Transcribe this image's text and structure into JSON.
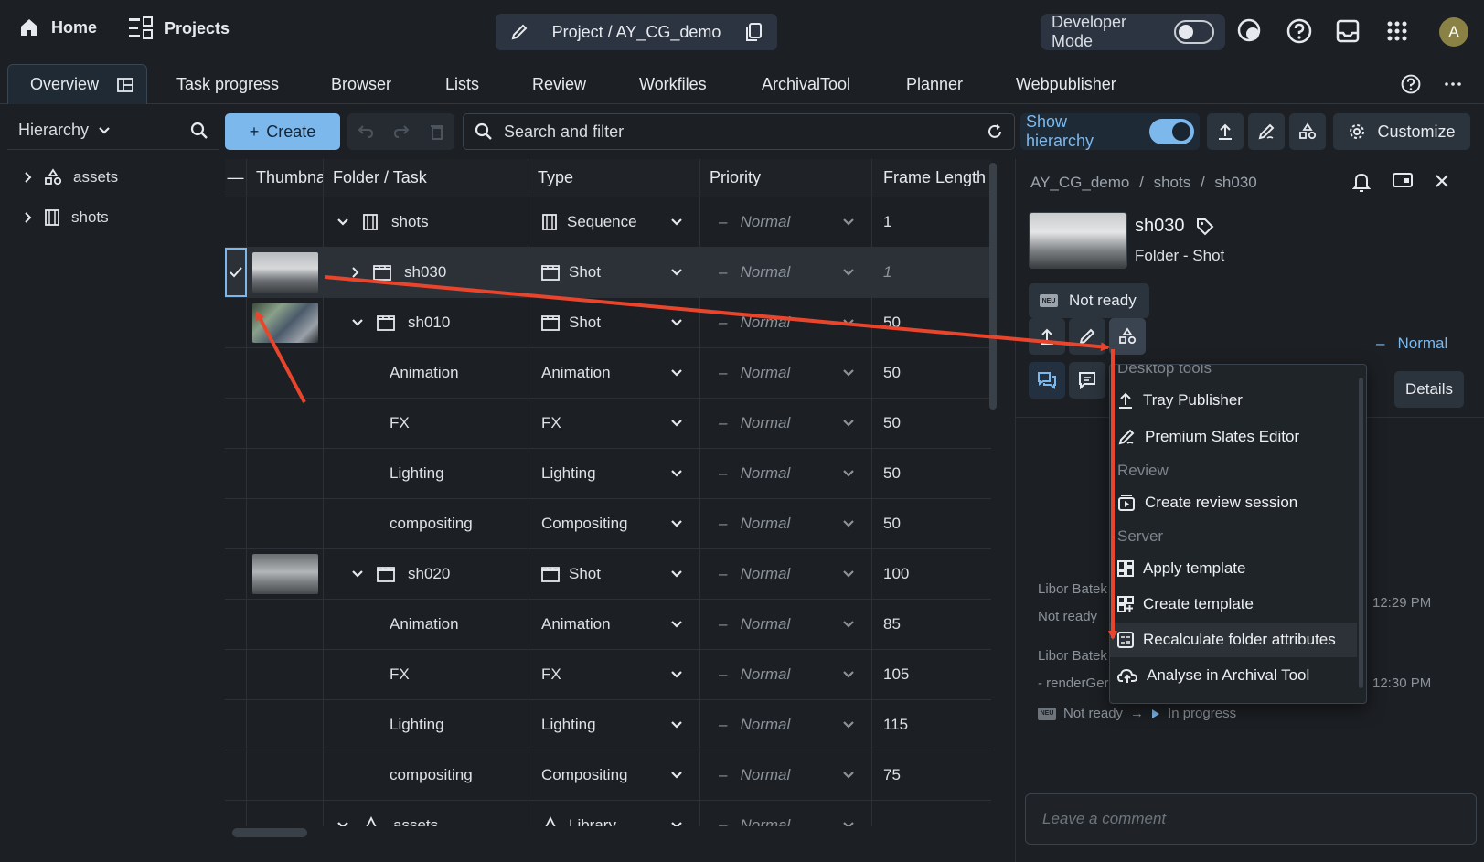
{
  "topbar": {
    "home_label": "Home",
    "projects_label": "Projects",
    "project_title": "Project / AY_CG_demo",
    "dev_mode_label": "Developer Mode",
    "avatar_initial": "A"
  },
  "tabs": [
    {
      "label": "Overview"
    },
    {
      "label": "Task progress"
    },
    {
      "label": "Browser"
    },
    {
      "label": "Lists"
    },
    {
      "label": "Review"
    },
    {
      "label": "Workfiles"
    },
    {
      "label": "ArchivalTool"
    },
    {
      "label": "Planner"
    },
    {
      "label": "Webpublisher"
    }
  ],
  "sidebar": {
    "title": "Hierarchy",
    "items": [
      {
        "label": "assets",
        "icon": "library-icon"
      },
      {
        "label": "shots",
        "icon": "film-icon"
      }
    ]
  },
  "toolbar": {
    "create_label": "Create",
    "search_placeholder": "Search and filter",
    "show_hierarchy_label": "Show hierarchy",
    "customize_label": "Customize"
  },
  "table": {
    "headers": [
      "—",
      "Thumbnail",
      "Folder / Task",
      "Type",
      "Priority",
      "Frame Length"
    ],
    "rows": [
      {
        "name": "shots",
        "type": "Sequence",
        "priority": "Normal",
        "frames": "1"
      },
      {
        "name": "sh030",
        "type": "Shot",
        "priority": "Normal",
        "frames": "1"
      },
      {
        "name": "sh010",
        "type": "Shot",
        "priority": "Normal",
        "frames": "50"
      },
      {
        "name": "Animation",
        "type": "Animation",
        "priority": "Normal",
        "frames": "50"
      },
      {
        "name": "FX",
        "type": "FX",
        "priority": "Normal",
        "frames": "50"
      },
      {
        "name": "Lighting",
        "type": "Lighting",
        "priority": "Normal",
        "frames": "50"
      },
      {
        "name": "compositing",
        "type": "Compositing",
        "priority": "Normal",
        "frames": "50"
      },
      {
        "name": "sh020",
        "type": "Shot",
        "priority": "Normal",
        "frames": "100"
      },
      {
        "name": "Animation",
        "type": "Animation",
        "priority": "Normal",
        "frames": "85"
      },
      {
        "name": "FX",
        "type": "FX",
        "priority": "Normal",
        "frames": "105"
      },
      {
        "name": "Lighting",
        "type": "Lighting",
        "priority": "Normal",
        "frames": "115"
      },
      {
        "name": "compositing",
        "type": "Compositing",
        "priority": "Normal",
        "frames": "75"
      },
      {
        "name": "assets",
        "type": "Library",
        "priority": "Normal",
        "frames": ""
      }
    ]
  },
  "details": {
    "breadcrumb": [
      "AY_CG_demo",
      "shots",
      "sh030"
    ],
    "breadcrumb_sep": "/",
    "name": "sh030",
    "subtitle": "Folder -  Shot",
    "status": "Not ready",
    "priority": "Normal",
    "details_label": "Details",
    "activity": [
      {
        "author": "Libor Batek",
        "text": "Not ready",
        "time": "12:29 PM"
      },
      {
        "author": "Libor Batek",
        "text": "- renderGer",
        "time": "12:30 PM",
        "from": "Not ready",
        "arrow": "→",
        "to": "In progress"
      }
    ],
    "comment_placeholder": "Leave a comment"
  },
  "menu": {
    "sections": [
      {
        "title": "Desktop tools",
        "items": [
          {
            "label": "Tray Publisher",
            "icon": "upload-icon"
          },
          {
            "label": "Premium Slates Editor",
            "icon": "edit-icon"
          }
        ]
      },
      {
        "title": "Review",
        "items": [
          {
            "label": "Create review session",
            "icon": "review-icon"
          }
        ]
      },
      {
        "title": "Server",
        "items": [
          {
            "label": "Apply template",
            "icon": "template-icon"
          },
          {
            "label": "Create template",
            "icon": "template-add-icon"
          },
          {
            "label": "Recalculate folder attributes",
            "icon": "calculator-icon"
          },
          {
            "label": "Analyse in Archival Tool",
            "icon": "cloud-icon"
          }
        ]
      }
    ]
  },
  "colors": {
    "accent": "#7db8ec",
    "arrow": "#e8452c",
    "background": "#1c1f23"
  }
}
